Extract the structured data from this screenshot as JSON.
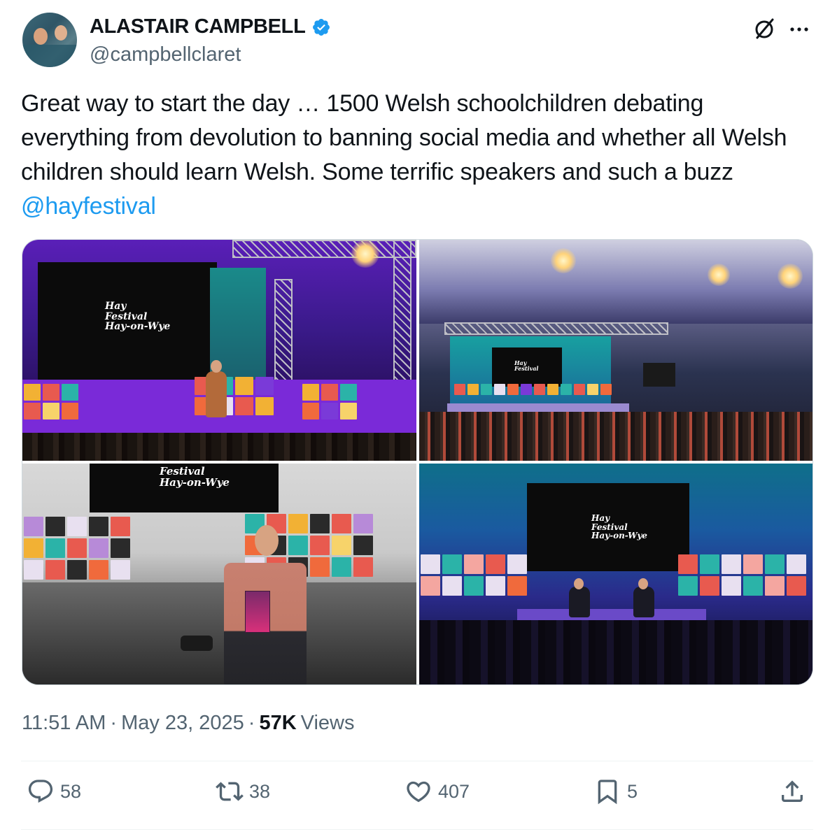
{
  "author": {
    "name": "ALASTAIR CAMPBELL",
    "handle": "@campbellclaret",
    "verified": true
  },
  "tweet": {
    "text": "Great way to start the day … 1500 Welsh schoolchildren debating everything from devolution to banning social media and whether all Welsh children should learn Welsh. Some terrific speakers and such a buzz ",
    "mention": "@hayfestival"
  },
  "media": {
    "photos": [
      {
        "logo_line1": "Hay",
        "logo_line2": "Festival",
        "logo_line3": "Hay-on-Wye"
      },
      {
        "logo_line1": "Hay",
        "logo_line2": "Festival",
        "logo_line3": ""
      },
      {
        "logo_line1": "Festival",
        "logo_line2": "Hay-on-Wye",
        "logo_line3": ""
      },
      {
        "logo_line1": "Hay",
        "logo_line2": "Festival",
        "logo_line3": "Hay-on-Wye"
      }
    ]
  },
  "meta": {
    "time": "11:51 AM",
    "date": "May 23, 2025",
    "separator": "·",
    "views_count": "57K",
    "views_label": "Views"
  },
  "actions": {
    "replies": "58",
    "reposts": "38",
    "likes": "407",
    "bookmarks": "5"
  },
  "colors": {
    "accent": "#1d9bf0",
    "text_primary": "#0f1419",
    "text_secondary": "#536471",
    "divider": "#eff3f4"
  },
  "icons": [
    "verified-badge-icon",
    "grok-icon",
    "more-icon",
    "reply-icon",
    "repost-icon",
    "like-icon",
    "bookmark-icon",
    "share-icon"
  ]
}
